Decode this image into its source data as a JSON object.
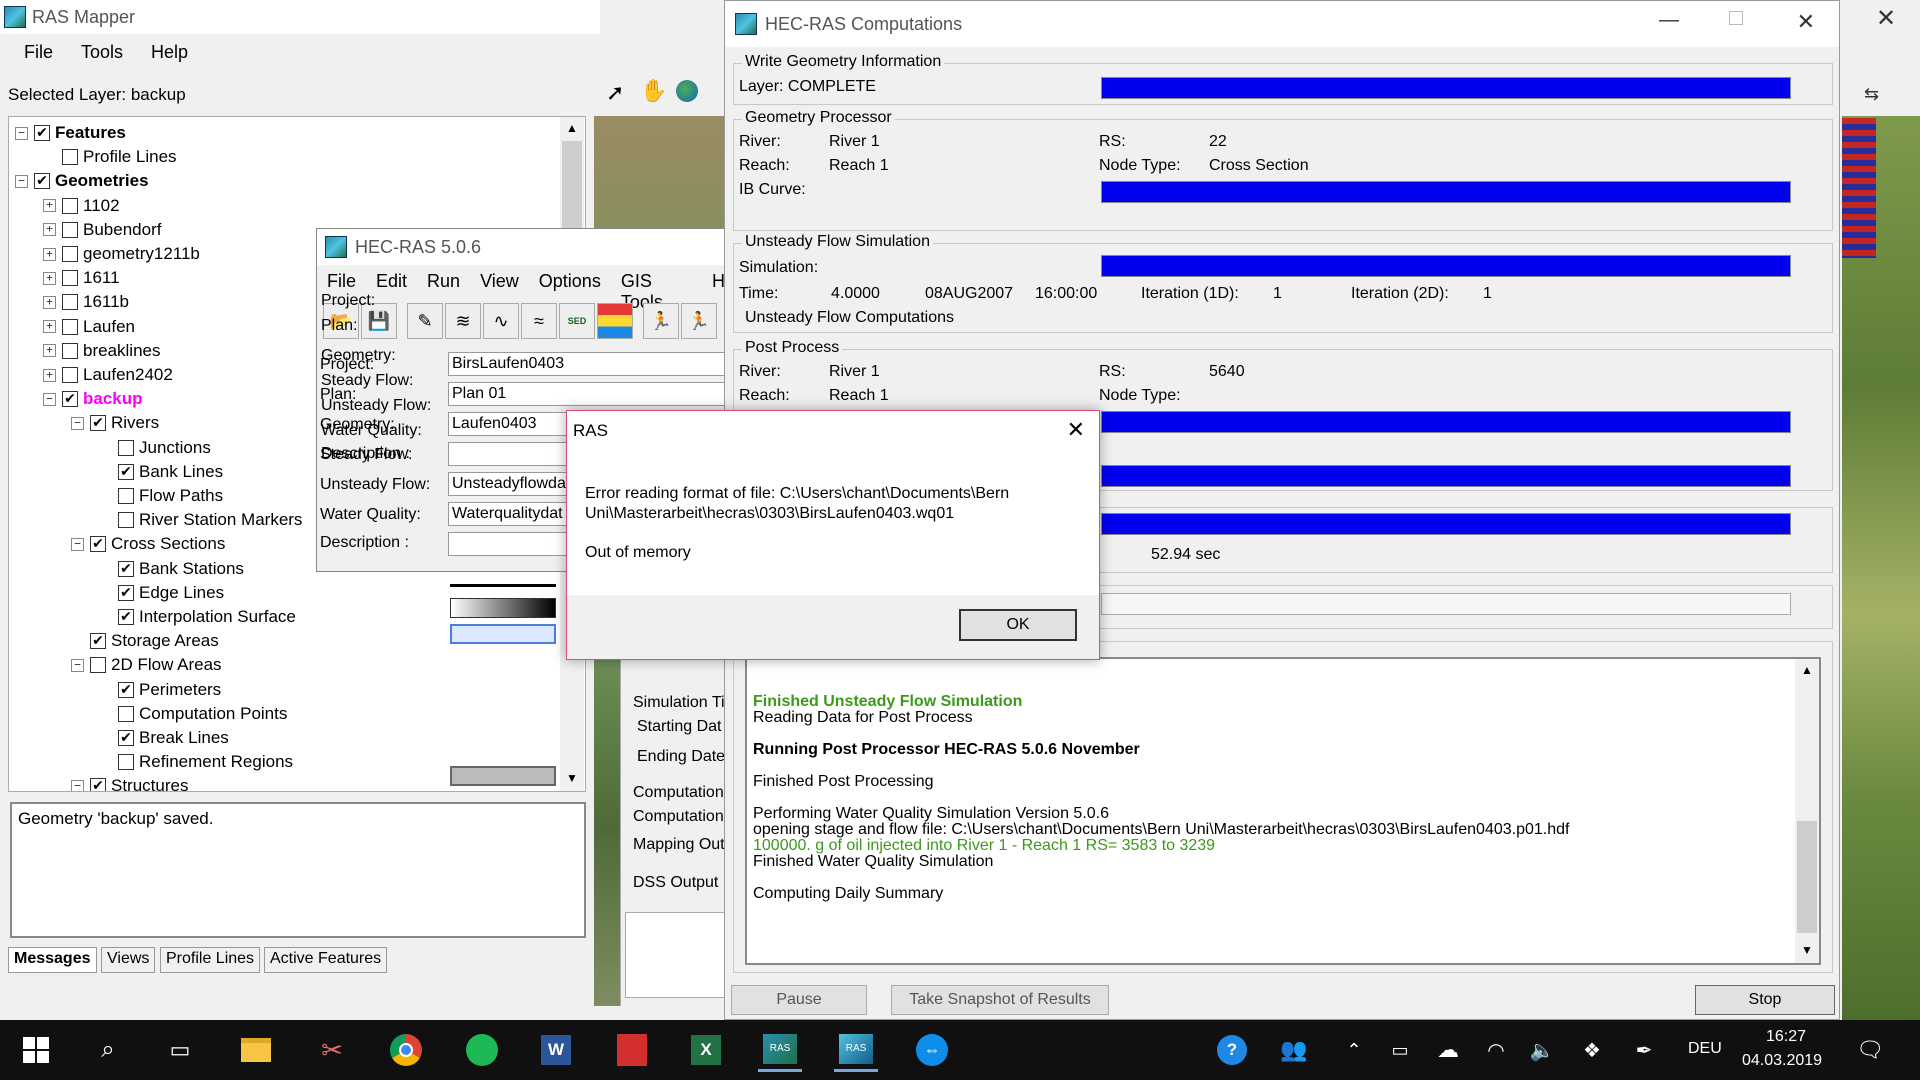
{
  "ras_mapper": {
    "title": "RAS Mapper",
    "menu": [
      "File",
      "Tools",
      "Help"
    ],
    "selected_layer": "Selected Layer: backup",
    "tree": [
      {
        "label": "Features",
        "indent": 0,
        "expander": "-",
        "checked": true,
        "bold": true
      },
      {
        "label": "Profile Lines",
        "indent": 1,
        "expander": "",
        "checked": false
      },
      {
        "label": "Geometries",
        "indent": 0,
        "expander": "-",
        "checked": true,
        "bold": true
      },
      {
        "label": "1102",
        "indent": 1,
        "expander": "+",
        "checked": false
      },
      {
        "label": "Bubendorf",
        "indent": 1,
        "expander": "+",
        "checked": false
      },
      {
        "label": "geometry1211b",
        "indent": 1,
        "expander": "+",
        "checked": false
      },
      {
        "label": "1611",
        "indent": 1,
        "expander": "+",
        "checked": false
      },
      {
        "label": "1611b",
        "indent": 1,
        "expander": "+",
        "checked": false
      },
      {
        "label": "Laufen",
        "indent": 1,
        "expander": "+",
        "checked": false
      },
      {
        "label": "breaklines",
        "indent": 1,
        "expander": "+",
        "checked": false
      },
      {
        "label": "Laufen2402",
        "indent": 1,
        "expander": "+",
        "checked": false
      },
      {
        "label": "backup",
        "indent": 1,
        "expander": "-",
        "checked": true,
        "highlight": true
      },
      {
        "label": "Rivers",
        "indent": 2,
        "expander": "-",
        "checked": true
      },
      {
        "label": "Junctions",
        "indent": 3,
        "expander": "",
        "checked": false
      },
      {
        "label": "Bank Lines",
        "indent": 3,
        "expander": "",
        "checked": true
      },
      {
        "label": "Flow Paths",
        "indent": 3,
        "expander": "",
        "checked": false
      },
      {
        "label": "River Station Markers",
        "indent": 3,
        "expander": "",
        "checked": false
      },
      {
        "label": "Cross Sections",
        "indent": 2,
        "expander": "-",
        "checked": true
      },
      {
        "label": "Bank Stations",
        "indent": 3,
        "expander": "",
        "checked": true
      },
      {
        "label": "Edge Lines",
        "indent": 3,
        "expander": "",
        "checked": true
      },
      {
        "label": "Interpolation Surface",
        "indent": 3,
        "expander": "",
        "checked": true
      },
      {
        "label": "Storage Areas",
        "indent": 2,
        "expander": "",
        "checked": true
      },
      {
        "label": "2D Flow Areas",
        "indent": 2,
        "expander": "-",
        "checked": false
      },
      {
        "label": "Perimeters",
        "indent": 3,
        "expander": "",
        "checked": true
      },
      {
        "label": "Computation Points",
        "indent": 3,
        "expander": "",
        "checked": false
      },
      {
        "label": "Break Lines",
        "indent": 3,
        "expander": "",
        "checked": true
      },
      {
        "label": "Refinement Regions",
        "indent": 3,
        "expander": "",
        "checked": false
      },
      {
        "label": "Structures",
        "indent": 2,
        "expander": "-",
        "checked": true
      }
    ],
    "message": "Geometry 'backup' saved.",
    "tabs": [
      "Messages",
      "Views",
      "Profile Lines",
      "Active Features"
    ]
  },
  "hecras": {
    "title": "HEC-RAS 5.0.6",
    "menu": [
      "File",
      "Edit",
      "Run",
      "View",
      "Options",
      "GIS Tools",
      "H"
    ],
    "labels": {
      "project": "Project:",
      "plan": "Plan:",
      "geometry": "Geometry:",
      "steady": "Steady Flow:",
      "unsteady": "Unsteady Flow:",
      "wq": "Water Quality:",
      "desc": "Description :"
    },
    "values": {
      "project": "BirsLaufen0403",
      "plan": "Plan 01",
      "geometry": "Laufen0403",
      "steady": "",
      "unsteady": "Unsteadyflowda",
      "wq": "Waterqualitydat",
      "desc": ""
    },
    "sed_label": "SED",
    "partial": {
      "sim_time": "Simulation Ti",
      "starting": "Starting Dat",
      "ending": "Ending Date",
      "comp1": "Computation",
      "comp2": "Computation",
      "mapping": "Mapping Out",
      "dss": "DSS Output I"
    }
  },
  "computations": {
    "title": "HEC-RAS Computations",
    "write_geometry": {
      "title": "Write Geometry Information",
      "layer": "Layer:  COMPLETE"
    },
    "geometry_processor": {
      "title": "Geometry Processor",
      "river_lbl": "River:",
      "river": "River 1",
      "reach_lbl": "Reach:",
      "reach": "Reach 1",
      "ib_lbl": "IB Curve:",
      "rs_lbl": "RS:",
      "rs": "22",
      "node_lbl": "Node Type:",
      "node": "Cross Section"
    },
    "unsteady": {
      "title": "Unsteady Flow Simulation",
      "sim_lbl": "Simulation:",
      "time_lbl": "Time:",
      "time": "4.0000",
      "date": "08AUG2007",
      "clock": "16:00:00",
      "iter1d_lbl": "Iteration (1D):",
      "iter1d": "1",
      "iter2d_lbl": "Iteration (2D):",
      "iter2d": "1",
      "status": "Unsteady Flow Computations"
    },
    "post": {
      "title": "Post Process",
      "river_lbl": "River:",
      "river": "River 1",
      "reach_lbl": "Reach:",
      "reach": "Reach 1",
      "rs_lbl": "RS:",
      "rs": "5640",
      "node_lbl": "Node Type:",
      "node": ""
    },
    "elapsed": "52.94 sec",
    "log": [
      {
        "text": "Finished Unsteady Flow Simulation",
        "color": "green",
        "bold": true
      },
      {
        "text": "Reading Data for Post Process",
        "color": "black",
        "bold": false
      },
      {
        "text": "Running Post Processor  HEC-RAS 5.0.6 November",
        "color": "black",
        "bold": true
      },
      {
        "text": "Finished Post Processing",
        "color": "black",
        "bold": false
      },
      {
        "text": "Performing Water Quality Simulation Version 5.0.6",
        "color": "black",
        "bold": false
      },
      {
        "text": "opening stage and flow file: C:\\Users\\chant\\Documents\\Bern Uni\\Masterarbeit\\hecras\\0303\\BirsLaufen0403.p01.hdf",
        "color": "black",
        "bold": false
      },
      {
        "text": "100000. g of oil injected into River 1 - Reach 1  RS= 3583 to 3239",
        "color": "green",
        "bold": false
      },
      {
        "text": "Finished Water Quality Simulation",
        "color": "black",
        "bold": false
      },
      {
        "text": "Computing Daily Summary",
        "color": "black",
        "bold": false
      }
    ],
    "buttons": {
      "pause": "Pause",
      "snapshot": "Take Snapshot of Results",
      "stop": "Stop"
    }
  },
  "dialog": {
    "title": "RAS",
    "line1": "Error reading format of file: C:\\Users\\chant\\Documents\\Bern",
    "line2": "Uni\\Masterarbeit\\hecras\\0303\\BirsLaufen0403.wq01",
    "line3": "Out of memory",
    "ok": "OK"
  },
  "taskbar": {
    "lang": "DEU",
    "time": "16:27",
    "date": "04.03.2019",
    "word_label": "W",
    "excel_label": "X",
    "ras_label": "RAS"
  },
  "colors": {
    "progress": "#0000ee",
    "highlight": "#ff00ff",
    "log_green": "#3c9a1a",
    "taskbar": "#101010",
    "dialog_border": "#e0488a"
  }
}
